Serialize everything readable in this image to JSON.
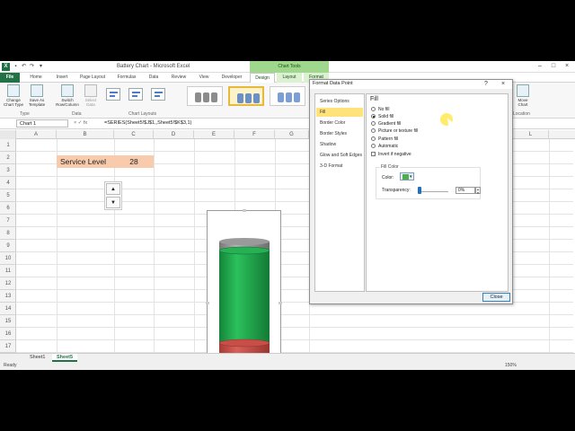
{
  "titlebar": {
    "window_title": "Battery Chart - Microsoft Excel",
    "context_group": "Chart Tools",
    "app_icon": "X"
  },
  "ribbon_tabs": [
    "File",
    "Home",
    "Insert",
    "Page Layout",
    "Formulas",
    "Data",
    "Review",
    "View",
    "Developer",
    "Design",
    "Layout",
    "Format"
  ],
  "active_tab": "Design",
  "ribbon": {
    "type_group": {
      "label": "Type",
      "buttons": [
        "Change Chart Type",
        "Save As Template"
      ]
    },
    "data_group": {
      "label": "Data",
      "buttons": [
        "Switch Row/Column",
        "Select Data"
      ]
    },
    "layouts_label": "Chart Layouts",
    "location_group": {
      "label": "Location",
      "button": "Move Chart"
    }
  },
  "formula_bar": {
    "name_box": "Chart 1",
    "formula": "=SERIES(Sheet5!$J$1,,Sheet5!$K$3,1)"
  },
  "columns": [
    "A",
    "B",
    "C",
    "D",
    "E",
    "F",
    "G",
    "L"
  ],
  "rows": [
    "1",
    "2",
    "3",
    "4",
    "5",
    "6",
    "7",
    "8",
    "9",
    "10",
    "11",
    "12",
    "13",
    "14",
    "15",
    "16",
    "17"
  ],
  "cells": {
    "service_level_label": "Service Level",
    "service_level_value": "28"
  },
  "spinner": {
    "up_glyph": "▲",
    "down_glyph": "▼"
  },
  "chart": {
    "green_color": "#1ea34a",
    "red_color": "#c8504a",
    "cap_color": "#8a8a8a"
  },
  "sheet_tabs": [
    "Sheet1",
    "Sheet5"
  ],
  "active_sheet": "Sheet5",
  "status": {
    "ready": "Ready",
    "zoom": "150%"
  },
  "dialog": {
    "title": "Format Data Point",
    "help": "?",
    "close_glyph": "×",
    "nav": [
      "Series Options",
      "Fill",
      "Border Color",
      "Border Styles",
      "Shadow",
      "Glow and Soft Edges",
      "3-D Format"
    ],
    "selected_nav": "Fill",
    "fill_heading": "Fill",
    "fill_options": [
      "No fill",
      "Solid fill",
      "Gradient fill",
      "Picture or texture fill",
      "Pattern fill",
      "Automatic"
    ],
    "selected_fill": "Solid fill",
    "invert_label": "Invert if negative",
    "fill_color_heading": "Fill Color",
    "color_label": "Color:",
    "selected_color": "#4cae4c",
    "transparency_label": "Transparency:",
    "transparency_value": "0%",
    "transparency_fraction": 0,
    "close_button": "Close"
  }
}
